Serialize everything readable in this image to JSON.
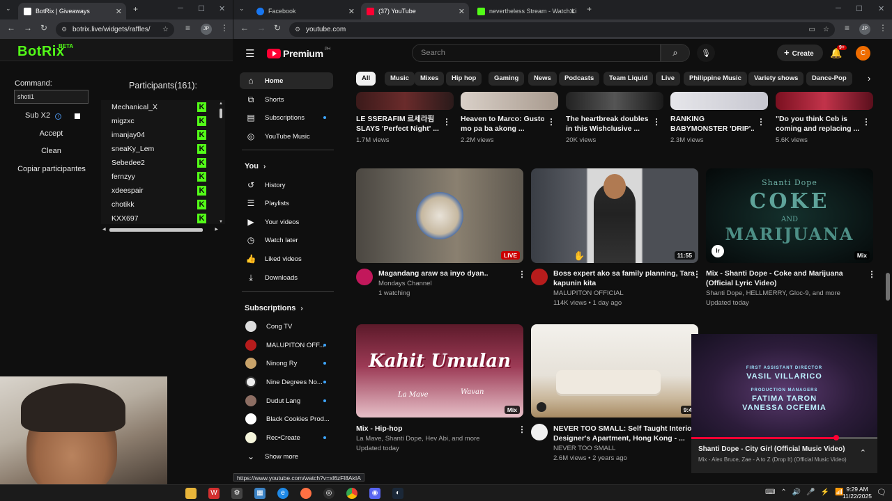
{
  "left_browser": {
    "tab_title": "BotRix | Giveaways",
    "url": "botrix.live/widgets/raffles/",
    "profile": "JP"
  },
  "right_browser": {
    "tabs": [
      {
        "title": "Facebook"
      },
      {
        "title": "(37) YouTube"
      },
      {
        "title": "nevertheless Stream - Watch Li"
      }
    ],
    "url": "youtube.com",
    "profile": "JP"
  },
  "botrix": {
    "logo": "BotRix",
    "beta": "BETA",
    "command_label": "Command:",
    "command_value": "shoti1",
    "sub_label": "Sub X2",
    "sub_info": "i",
    "accept": "Accept",
    "clean": "Clean",
    "copy": "Copiar participantes",
    "participants_title": "Participants(161):",
    "participants": [
      "Mechanical_X",
      "migzxc",
      "imanjay04",
      "sneaKy_Lem",
      "Sebedee2",
      "fernzyy",
      "xdeespair",
      "chotikk",
      "KXX697"
    ],
    "badge": "K"
  },
  "youtube": {
    "logo": "Premium",
    "region": "PH",
    "search_placeholder": "Search",
    "create": "Create",
    "notif_count": "9+",
    "avatar_letter": "C",
    "sidebar": {
      "main": [
        {
          "label": "Home"
        },
        {
          "label": "Shorts"
        },
        {
          "label": "Subscriptions"
        },
        {
          "label": "YouTube Music"
        }
      ],
      "you_header": "You",
      "you": [
        {
          "label": "History"
        },
        {
          "label": "Playlists"
        },
        {
          "label": "Your videos"
        },
        {
          "label": "Watch later"
        },
        {
          "label": "Liked videos"
        },
        {
          "label": "Downloads"
        }
      ],
      "subs_header": "Subscriptions",
      "subs": [
        {
          "label": "Cong TV"
        },
        {
          "label": "MALUPITON OFF..."
        },
        {
          "label": "Ninong Ry"
        },
        {
          "label": "Nine Degrees No..."
        },
        {
          "label": "Dudut Lang"
        },
        {
          "label": "Black Cookies Prod..."
        },
        {
          "label": "Rec•Create"
        }
      ],
      "show_more": "Show more"
    },
    "chips": [
      "All",
      "Music",
      "Mixes",
      "Hip hop",
      "Gaming",
      "News",
      "Podcasts",
      "Team Liquid",
      "Live",
      "Philippine Music",
      "Variety shows",
      "Dance-Pop"
    ],
    "row1": [
      {
        "title1": "LE SSERAFIM 르세라핌",
        "title2": "SLAYS 'Perfect Night' ...",
        "meta": "1.7M views"
      },
      {
        "title1": "Heaven to Marco: Gusto",
        "title2": "mo pa ba akong ...",
        "meta": "2.2M views"
      },
      {
        "title1": "The heartbreak doubles",
        "title2": "in this Wishclusive ...",
        "meta": "20K views"
      },
      {
        "title1": "RANKING",
        "title2": "BABYMONSTER 'DRIP'...",
        "meta": "2.3M views"
      },
      {
        "title1": "\"Do you think Ceb is",
        "title2": "coming and replacing ...",
        "meta": "5.6K views"
      }
    ],
    "row2": [
      {
        "title1": "Magandang araw sa inyo dyan..",
        "title2": "",
        "channel": "Mondays Channel",
        "meta": "1 watching",
        "badge": "LIVE"
      },
      {
        "title1": "Boss expert ako sa family planning, Tara",
        "title2": "kapunin kita",
        "channel": "MALUPITON OFFICIAL",
        "meta": "114K views • 1 day ago",
        "badge": "11:55"
      },
      {
        "title1": "Mix - Shanti Dope - Coke and Marijuana",
        "title2": "(Official Lyric Video)",
        "channel": "Shanti Dope, HELLMERRY, Gloc-9, and more",
        "meta": "Updated today",
        "badge": "Mix"
      }
    ],
    "row3": [
      {
        "title1": "Mix - Hip-hop",
        "title2": "",
        "channel": "La Mave, Shanti Dope, Hev Abi, and more",
        "meta": "Updated today",
        "badge": "Mix"
      },
      {
        "title1": "NEVER TOO SMALL: Self Taught Interior",
        "title2": "Designer's Apartment, Hong Kong - ...",
        "channel": "NEVER TOO SMALL",
        "meta": "2.6M views • 2 years ago",
        "badge": "9:4"
      }
    ],
    "thumb_text": {
      "kahit": "Kahit Umulan",
      "lamave": "La Mave",
      "wavan": "Wavan",
      "coke1": "Shanti Dope",
      "coke2": "COKE",
      "coke3": "AND",
      "coke4": "MARIJUANA"
    },
    "miniplayer": {
      "credit1": "FIRST ASSISTANT DIRECTOR",
      "credit2": "VASIL VILLARICO",
      "credit3": "PRODUCTION MANAGERS",
      "credit4": "FATIMA TARON",
      "credit5": "VANESSA OCFEMIA",
      "title": "Shanti Dope - City Girl (Official Music Video)",
      "sub": "Mix - Alex Bruce, Zae - A to Z (Drop It) (Official Music Video)",
      "progress": 0.78
    },
    "status_url": "https://www.youtube.com/watch?v=xl6zFl8AkIA"
  },
  "taskbar": {
    "time": "9:29 AM",
    "date": "11/22/2025"
  }
}
